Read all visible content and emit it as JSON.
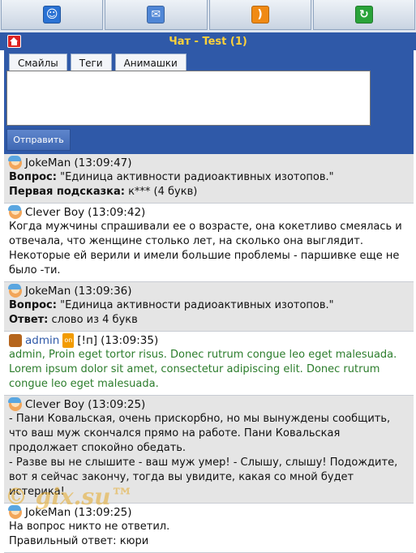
{
  "toolbar": {
    "icons": [
      "user-icon",
      "mail-icon",
      "rss-icon",
      "refresh-icon"
    ]
  },
  "title": "Чат - Test (1)",
  "tabs": [
    "Смайлы",
    "Теги",
    "Анимашки"
  ],
  "send_label": "Отправить",
  "messages": [
    {
      "name": "JokeMan",
      "time": "(13:09:47)",
      "q_label": "Вопрос:",
      "q_text": " \"Единица активности радиоактивных изотопов.\"",
      "h_label": "Первая подсказка:",
      "h_text": " к*** (4 букв)"
    },
    {
      "name": "Clever Boy",
      "time": "(13:09:42)",
      "text": "Когда мужчины спрашивали ее о возрасте, она кокетливо смеялась и отвечала, что женщине столько лет, на сколько она выглядит. Некоторые ей верили и имели большие проблемы - паршивке еще не было -ти."
    },
    {
      "name": "JokeMan",
      "time": "(13:09:36)",
      "q_label": "Вопрос:",
      "q_text": " \"Единица активности радиоактивных изотопов.\"",
      "a_label": "Ответ:",
      "a_text": " слово из 4 букв"
    },
    {
      "name": "admin",
      "badge": "on",
      "tag": "[!п]",
      "time": "(13:09:35)",
      "text": "admin, Proin eget tortor risus. Donec rutrum congue leo eget malesuada. Lorem ipsum dolor sit amet, consectetur adipiscing elit. Donec rutrum congue leo eget malesuada."
    },
    {
      "name": "Clever Boy",
      "time": "(13:09:25)",
      "line1": "- Пани Ковальская, очень прискорбно, но мы вынуждены сообщить, что ваш муж скончался прямо на работе. Пани Ковальская продолжает спокойно обедать.",
      "line2": "- Разве вы не слышите - ваш муж умер! - Слышу, слышу! Подождите, вот я сейчас закончу, тогда вы увидите, какая со мной будет истерика!"
    },
    {
      "name": "JokeMan",
      "time": "(13:09:25)",
      "line1": "На вопрос никто не ответил.",
      "line2": "Правильный ответ: кюри"
    }
  ],
  "watermark": "© gix.su™"
}
